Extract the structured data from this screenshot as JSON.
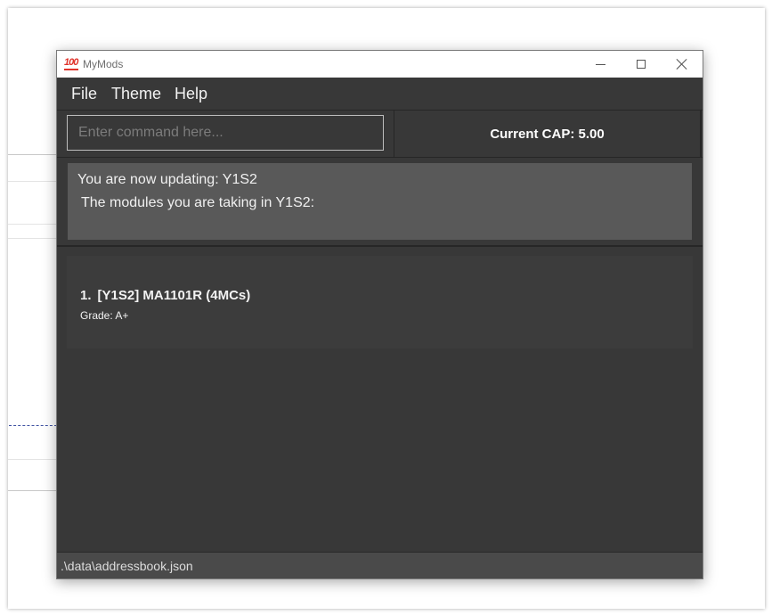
{
  "window": {
    "title": "MyMods",
    "icon": "hundred-points-icon"
  },
  "menu": {
    "items": [
      {
        "label": "File"
      },
      {
        "label": "Theme"
      },
      {
        "label": "Help"
      }
    ]
  },
  "command": {
    "placeholder": "Enter command here...",
    "value": ""
  },
  "cap": {
    "text": "Current CAP: 5.00"
  },
  "result": {
    "line1": "You are now updating: Y1S2",
    "line2": "The modules you are taking in Y1S2:"
  },
  "modules": [
    {
      "index": "1.",
      "heading": "[Y1S2] MA1101R (4MCs)",
      "grade": "Grade: A+"
    }
  ],
  "status": {
    "path": ".\\data\\addressbook.json"
  },
  "colors": {
    "window_bg": "#383838",
    "result_bg": "#595959",
    "card_bg": "#3c3c3c",
    "status_bg": "#4a4a4a",
    "accent_dash": "#3c4fa0"
  }
}
